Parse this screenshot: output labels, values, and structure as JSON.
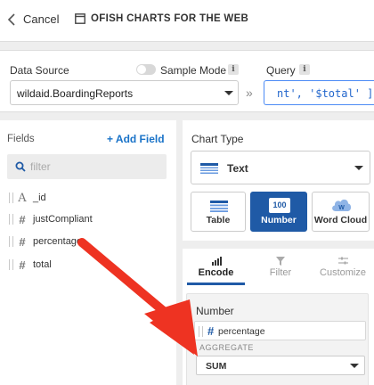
{
  "header": {
    "back_label": "Cancel",
    "title": "OFISH CHARTS FOR THE WEB"
  },
  "data_source": {
    "label": "Data Source",
    "value": "wildaid.BoardingReports",
    "sample_mode_label": "Sample Mode",
    "sample_mode_on": false,
    "info_glyph": "i",
    "query_label": "Query",
    "query_text": "nt', '$total' ]"
  },
  "fields": {
    "title": "Fields",
    "add_label": "+ Add Field",
    "search_placeholder": "filter",
    "items": [
      {
        "type_glyph": "A",
        "name": "_id"
      },
      {
        "type_glyph": "#",
        "name": "justCompliant"
      },
      {
        "type_glyph": "#",
        "name": "percentage"
      },
      {
        "type_glyph": "#",
        "name": "total"
      }
    ]
  },
  "chart_type": {
    "title": "Chart Type",
    "selected": "Text",
    "options": [
      {
        "label": "Table",
        "icon": "table-icon",
        "active": false
      },
      {
        "label": "Number",
        "icon": "number-icon",
        "badge": "100",
        "active": true
      },
      {
        "label": "Word Cloud",
        "icon": "word-cloud-icon",
        "badge": "W",
        "active": false
      }
    ]
  },
  "tabs": [
    {
      "label": "Encode",
      "icon": "bar-chart-icon",
      "active": true
    },
    {
      "label": "Filter",
      "icon": "filter-icon",
      "active": false
    },
    {
      "label": "Customize",
      "icon": "sliders-icon",
      "active": false
    }
  ],
  "encode": {
    "channel_label": "Number",
    "field_glyph": "#",
    "field_name": "percentage",
    "aggregate_label": "AGGREGATE",
    "aggregate_value": "SUM"
  },
  "colors": {
    "accent": "#1f5aa6",
    "link": "#1a73c8",
    "annotation_arrow": "#ee3322"
  }
}
